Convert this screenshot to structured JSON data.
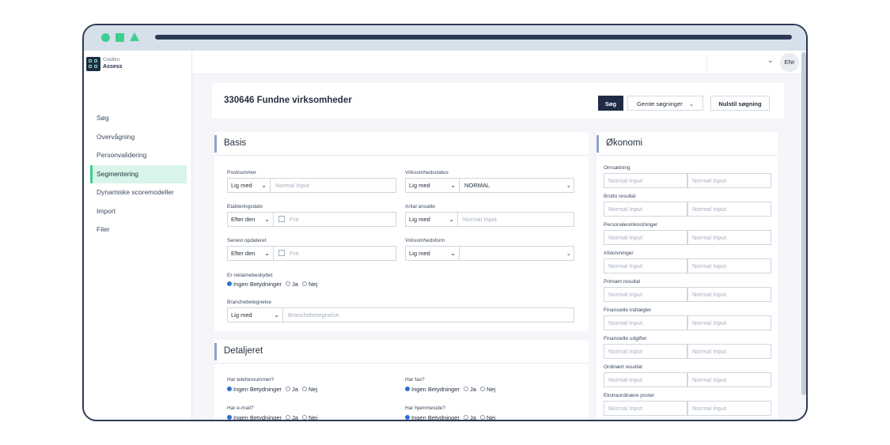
{
  "app": {
    "brand_line1": "Creditro",
    "brand_line2": "Assess"
  },
  "nav": {
    "items": [
      {
        "label": "Søg"
      },
      {
        "label": "Overvågning"
      },
      {
        "label": "Personvalidering"
      },
      {
        "label": "Segmentering",
        "active": true
      },
      {
        "label": "Dynamiske scoremodeller"
      },
      {
        "label": "Import"
      },
      {
        "label": "Filer"
      }
    ]
  },
  "topbar": {
    "avatar": "ENr"
  },
  "header": {
    "title": "330646 Fundne virksomheder",
    "search_button": "Søg",
    "saved_searches": "Gemte søgninger",
    "reset_button": "Nulstil søgning"
  },
  "basis": {
    "title": "Basis",
    "postnummer": {
      "label": "Postnummer",
      "op": "Lig med",
      "placeholder": "Normal Input"
    },
    "status": {
      "label": "Virksomhedsstatus",
      "op": "Lig med",
      "value": "NORMAL"
    },
    "etablering": {
      "label": "Etableringsdato",
      "op": "Efter den",
      "placeholder": "Fra"
    },
    "ansatte": {
      "label": "Antal ansatte",
      "op": "Lig med",
      "placeholder": "Normal Input"
    },
    "opdateret": {
      "label": "Senest opdateret",
      "op": "Efter den",
      "placeholder": "Fra"
    },
    "form": {
      "label": "Virksomhedsform",
      "op": "Lig med",
      "value": ""
    },
    "reklame": {
      "label": "Er reklamebeskyttet",
      "opt0": "Ingen Betydninger",
      "opt1": "Ja",
      "opt2": "Nej"
    },
    "branche": {
      "label": "Branchebetegnelse",
      "op": "Lig med",
      "placeholder": "Branchebetegnelse"
    }
  },
  "detaljeret": {
    "title": "Detaljeret",
    "telefon": {
      "label": "Har telefonnummer?",
      "opt0": "Ingen Betydninger",
      "opt1": "Ja",
      "opt2": "Nej"
    },
    "fax": {
      "label": "Har fax?",
      "opt0": "Ingen Betydninger",
      "opt1": "Ja",
      "opt2": "Nej"
    },
    "email": {
      "label": "Har e-mail?",
      "opt0": "Ingen Betydninger",
      "opt1": "Ja",
      "opt2": "Nej"
    },
    "hjemmeside": {
      "label": "Har hjemmeside?",
      "opt0": "Ingen Betydninger",
      "opt1": "Ja",
      "opt2": "Nej"
    }
  },
  "okonomi": {
    "title": "Økonomi",
    "placeholder": "Normal Input",
    "rows": [
      "Omsætning",
      "Brutto resultat",
      "Personaleomkostninger",
      "Afskrivninger",
      "Primært resultat",
      "Finansielle indtægter",
      "Finansielle udgifter",
      "Ordinært resultat",
      "Ekstraordinære poster"
    ]
  }
}
